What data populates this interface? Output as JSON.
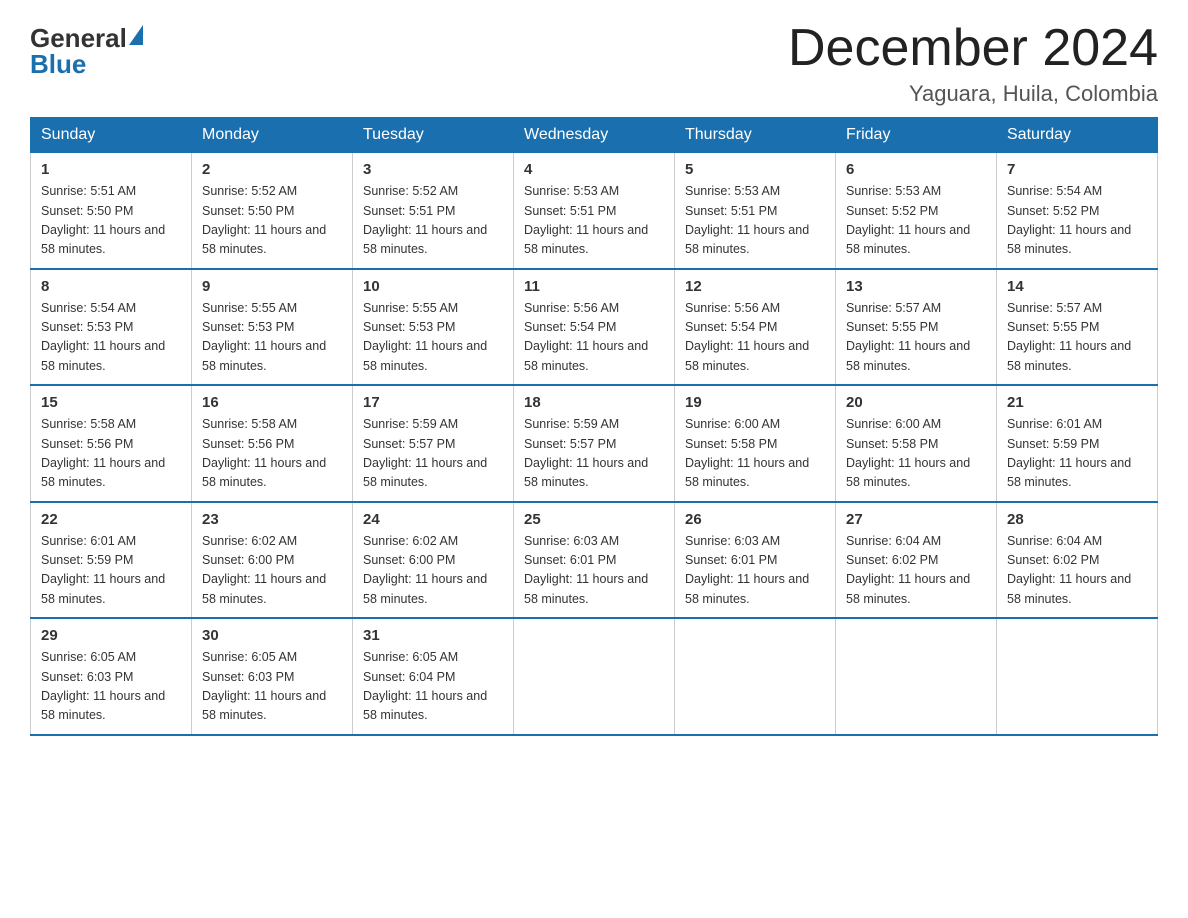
{
  "header": {
    "logo_general": "General",
    "logo_blue": "Blue",
    "title": "December 2024",
    "subtitle": "Yaguara, Huila, Colombia"
  },
  "days_of_week": [
    "Sunday",
    "Monday",
    "Tuesday",
    "Wednesday",
    "Thursday",
    "Friday",
    "Saturday"
  ],
  "weeks": [
    [
      {
        "day": "1",
        "sunrise": "5:51 AM",
        "sunset": "5:50 PM",
        "daylight": "11 hours and 58 minutes."
      },
      {
        "day": "2",
        "sunrise": "5:52 AM",
        "sunset": "5:50 PM",
        "daylight": "11 hours and 58 minutes."
      },
      {
        "day": "3",
        "sunrise": "5:52 AM",
        "sunset": "5:51 PM",
        "daylight": "11 hours and 58 minutes."
      },
      {
        "day": "4",
        "sunrise": "5:53 AM",
        "sunset": "5:51 PM",
        "daylight": "11 hours and 58 minutes."
      },
      {
        "day": "5",
        "sunrise": "5:53 AM",
        "sunset": "5:51 PM",
        "daylight": "11 hours and 58 minutes."
      },
      {
        "day": "6",
        "sunrise": "5:53 AM",
        "sunset": "5:52 PM",
        "daylight": "11 hours and 58 minutes."
      },
      {
        "day": "7",
        "sunrise": "5:54 AM",
        "sunset": "5:52 PM",
        "daylight": "11 hours and 58 minutes."
      }
    ],
    [
      {
        "day": "8",
        "sunrise": "5:54 AM",
        "sunset": "5:53 PM",
        "daylight": "11 hours and 58 minutes."
      },
      {
        "day": "9",
        "sunrise": "5:55 AM",
        "sunset": "5:53 PM",
        "daylight": "11 hours and 58 minutes."
      },
      {
        "day": "10",
        "sunrise": "5:55 AM",
        "sunset": "5:53 PM",
        "daylight": "11 hours and 58 minutes."
      },
      {
        "day": "11",
        "sunrise": "5:56 AM",
        "sunset": "5:54 PM",
        "daylight": "11 hours and 58 minutes."
      },
      {
        "day": "12",
        "sunrise": "5:56 AM",
        "sunset": "5:54 PM",
        "daylight": "11 hours and 58 minutes."
      },
      {
        "day": "13",
        "sunrise": "5:57 AM",
        "sunset": "5:55 PM",
        "daylight": "11 hours and 58 minutes."
      },
      {
        "day": "14",
        "sunrise": "5:57 AM",
        "sunset": "5:55 PM",
        "daylight": "11 hours and 58 minutes."
      }
    ],
    [
      {
        "day": "15",
        "sunrise": "5:58 AM",
        "sunset": "5:56 PM",
        "daylight": "11 hours and 58 minutes."
      },
      {
        "day": "16",
        "sunrise": "5:58 AM",
        "sunset": "5:56 PM",
        "daylight": "11 hours and 58 minutes."
      },
      {
        "day": "17",
        "sunrise": "5:59 AM",
        "sunset": "5:57 PM",
        "daylight": "11 hours and 58 minutes."
      },
      {
        "day": "18",
        "sunrise": "5:59 AM",
        "sunset": "5:57 PM",
        "daylight": "11 hours and 58 minutes."
      },
      {
        "day": "19",
        "sunrise": "6:00 AM",
        "sunset": "5:58 PM",
        "daylight": "11 hours and 58 minutes."
      },
      {
        "day": "20",
        "sunrise": "6:00 AM",
        "sunset": "5:58 PM",
        "daylight": "11 hours and 58 minutes."
      },
      {
        "day": "21",
        "sunrise": "6:01 AM",
        "sunset": "5:59 PM",
        "daylight": "11 hours and 58 minutes."
      }
    ],
    [
      {
        "day": "22",
        "sunrise": "6:01 AM",
        "sunset": "5:59 PM",
        "daylight": "11 hours and 58 minutes."
      },
      {
        "day": "23",
        "sunrise": "6:02 AM",
        "sunset": "6:00 PM",
        "daylight": "11 hours and 58 minutes."
      },
      {
        "day": "24",
        "sunrise": "6:02 AM",
        "sunset": "6:00 PM",
        "daylight": "11 hours and 58 minutes."
      },
      {
        "day": "25",
        "sunrise": "6:03 AM",
        "sunset": "6:01 PM",
        "daylight": "11 hours and 58 minutes."
      },
      {
        "day": "26",
        "sunrise": "6:03 AM",
        "sunset": "6:01 PM",
        "daylight": "11 hours and 58 minutes."
      },
      {
        "day": "27",
        "sunrise": "6:04 AM",
        "sunset": "6:02 PM",
        "daylight": "11 hours and 58 minutes."
      },
      {
        "day": "28",
        "sunrise": "6:04 AM",
        "sunset": "6:02 PM",
        "daylight": "11 hours and 58 minutes."
      }
    ],
    [
      {
        "day": "29",
        "sunrise": "6:05 AM",
        "sunset": "6:03 PM",
        "daylight": "11 hours and 58 minutes."
      },
      {
        "day": "30",
        "sunrise": "6:05 AM",
        "sunset": "6:03 PM",
        "daylight": "11 hours and 58 minutes."
      },
      {
        "day": "31",
        "sunrise": "6:05 AM",
        "sunset": "6:04 PM",
        "daylight": "11 hours and 58 minutes."
      },
      null,
      null,
      null,
      null
    ]
  ]
}
